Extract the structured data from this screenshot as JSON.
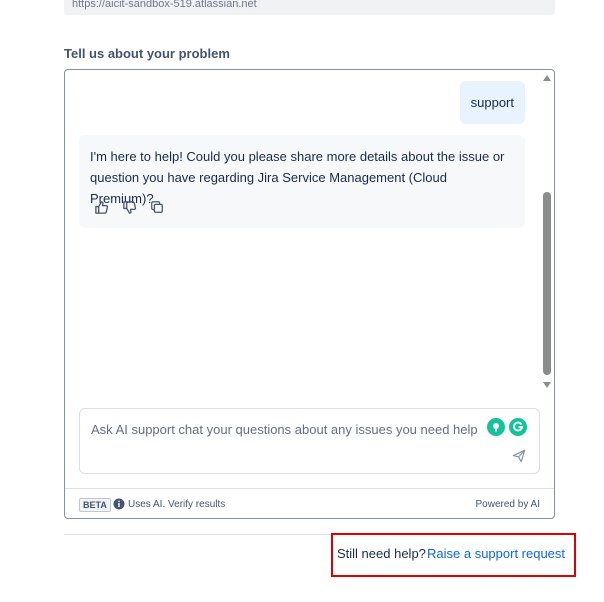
{
  "url": {
    "value": "https://aicit-sandbox-519.atlassian.net"
  },
  "form": {
    "problem_label": "Tell us about your problem"
  },
  "chat": {
    "messages": [
      {
        "role": "user",
        "text": "support"
      },
      {
        "role": "assistant",
        "text": "I'm here to help! Could you please share more details about the issue or question you have regarding Jira Service Management (Cloud Premium)?"
      }
    ],
    "feedback": [
      "thumbs-up-icon",
      "thumbs-down-icon",
      "copy-icon"
    ],
    "input": {
      "placeholder": "Ask AI support chat your questions about any issues you need help with",
      "value": ""
    },
    "footer": {
      "badge": "BETA",
      "note": "Uses AI. Verify results",
      "powered": "Powered by AI"
    }
  },
  "help": {
    "question": "Still need help?",
    "link": "Raise a support request"
  },
  "colors": {
    "link": "#0c66e4",
    "user_bubble": "#e9f2ff",
    "highlight_border": "#e00000",
    "grammarly": "#15c39a"
  }
}
